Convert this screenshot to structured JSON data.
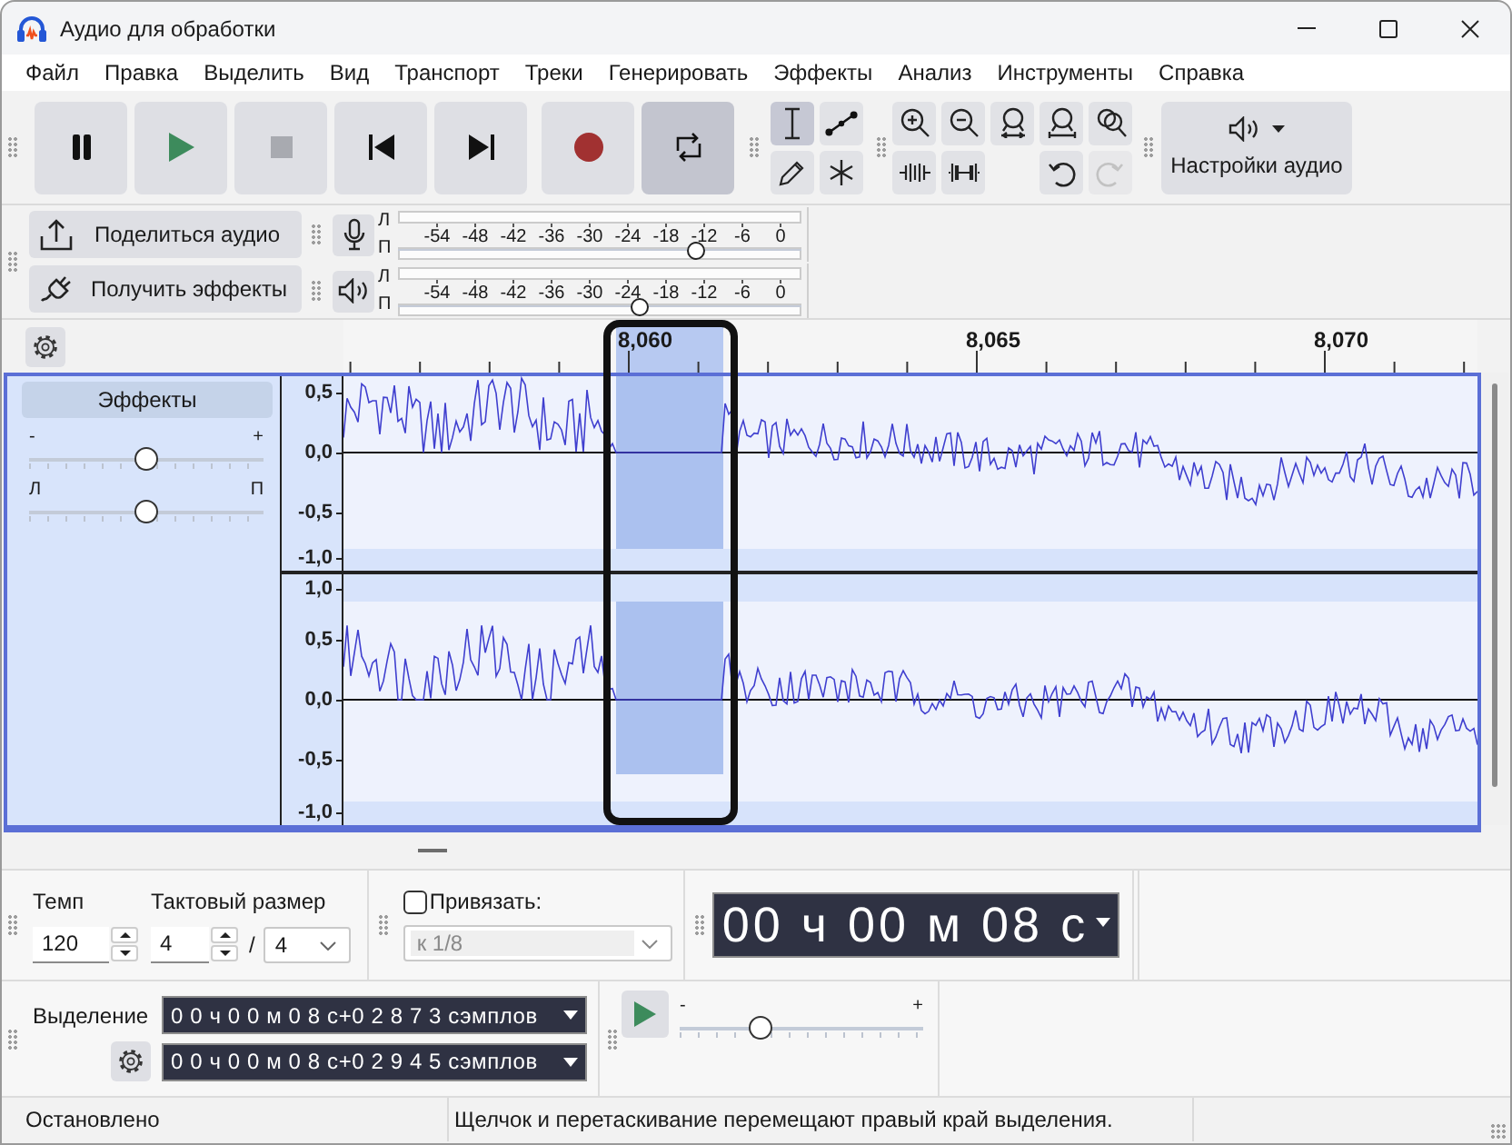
{
  "window": {
    "title": "Аудио для обработки"
  },
  "menu": [
    "Файл",
    "Правка",
    "Выделить",
    "Вид",
    "Транспорт",
    "Треки",
    "Генерировать",
    "Эффекты",
    "Анализ",
    "Инструменты",
    "Справка"
  ],
  "transport": [
    {
      "kind": "pause",
      "on": false
    },
    {
      "kind": "play",
      "on": false
    },
    {
      "kind": "stop",
      "on": false
    },
    {
      "kind": "skip_start",
      "on": false
    },
    {
      "kind": "skip_end",
      "on": false
    },
    {
      "kind": "record",
      "on": false
    },
    {
      "kind": "loop",
      "on": true
    }
  ],
  "tools": [
    {
      "kind": "select",
      "selected": true
    },
    {
      "kind": "envelope",
      "selected": false
    },
    {
      "kind": "draw",
      "selected": false
    },
    {
      "kind": "multi",
      "selected": false
    }
  ],
  "edit": [
    {
      "kind": "zoom_in",
      "disabled": false
    },
    {
      "kind": "zoom_out",
      "disabled": false
    },
    {
      "kind": "fit_selection",
      "disabled": false
    },
    {
      "kind": "fit_project",
      "disabled": false
    },
    {
      "kind": "zoom_toggle",
      "disabled": false
    },
    {
      "kind": "trim",
      "disabled": false
    },
    {
      "kind": "silence",
      "disabled": false
    },
    {
      "kind": "undo",
      "disabled": false
    },
    {
      "kind": "redo",
      "disabled": true
    }
  ],
  "audio_setup": {
    "label": "Настройки аудио"
  },
  "share_buttons": [
    {
      "kind": "share",
      "label": "Поделиться аудио"
    },
    {
      "kind": "effects",
      "label": "Получить эффекты"
    }
  ],
  "meters": [
    {
      "kind": "record",
      "channels": [
        "Л",
        "П"
      ],
      "scale": [
        "-54",
        "-48",
        "-42",
        "-36",
        "-30",
        "-24",
        "-18",
        "-12",
        "-6",
        "0"
      ],
      "level": 0.74
    },
    {
      "kind": "playback",
      "channels": [
        "Л",
        "П"
      ],
      "scale": [
        "-54",
        "-48",
        "-42",
        "-36",
        "-30",
        "-24",
        "-18",
        "-12",
        "-6",
        "0"
      ],
      "level": 0.6
    }
  ],
  "ruler": {
    "labels": [
      "8,060",
      "8,065",
      "8,070"
    ]
  },
  "track": {
    "selected": true,
    "effects_button": "Эффекты",
    "gain": {
      "min_label": "-",
      "max_label": "+",
      "level": 0.5
    },
    "pan": {
      "min_label": "Л",
      "max_label": "П",
      "level": 0.5
    },
    "channels": [
      {
        "scale": [
          "0,5",
          "0,0",
          "-0,5",
          "-1,0"
        ]
      },
      {
        "scale": [
          "1,0",
          "0,5",
          "0,0",
          "-0,5",
          "-1,0"
        ]
      }
    ]
  },
  "tempo": {
    "label": "Темп",
    "value": "120"
  },
  "time_signature": {
    "label": "Тактовый размер",
    "upper": "4",
    "separator": "/",
    "lower": "4"
  },
  "snap": {
    "label": "Привязать:",
    "checked": false,
    "value": "к 1/8",
    "disabled": true
  },
  "time_display": {
    "value": "00 ч 00 м 08 с"
  },
  "selection": {
    "label": "Выделение",
    "start": "0 0 ч 0 0 м 0 8 с+0 2 8 7 3 сэмплов",
    "end": "0 0 ч 0 0 м 0 8 с+0 2 9 4 5 сэмплов"
  },
  "play_at_speed": {
    "min_label": "-",
    "max_label": "+",
    "level": 0.33
  },
  "status_bar": {
    "state": "Остановлено",
    "message": "Щелчок и перетаскивание перемещают правый край выделения."
  }
}
